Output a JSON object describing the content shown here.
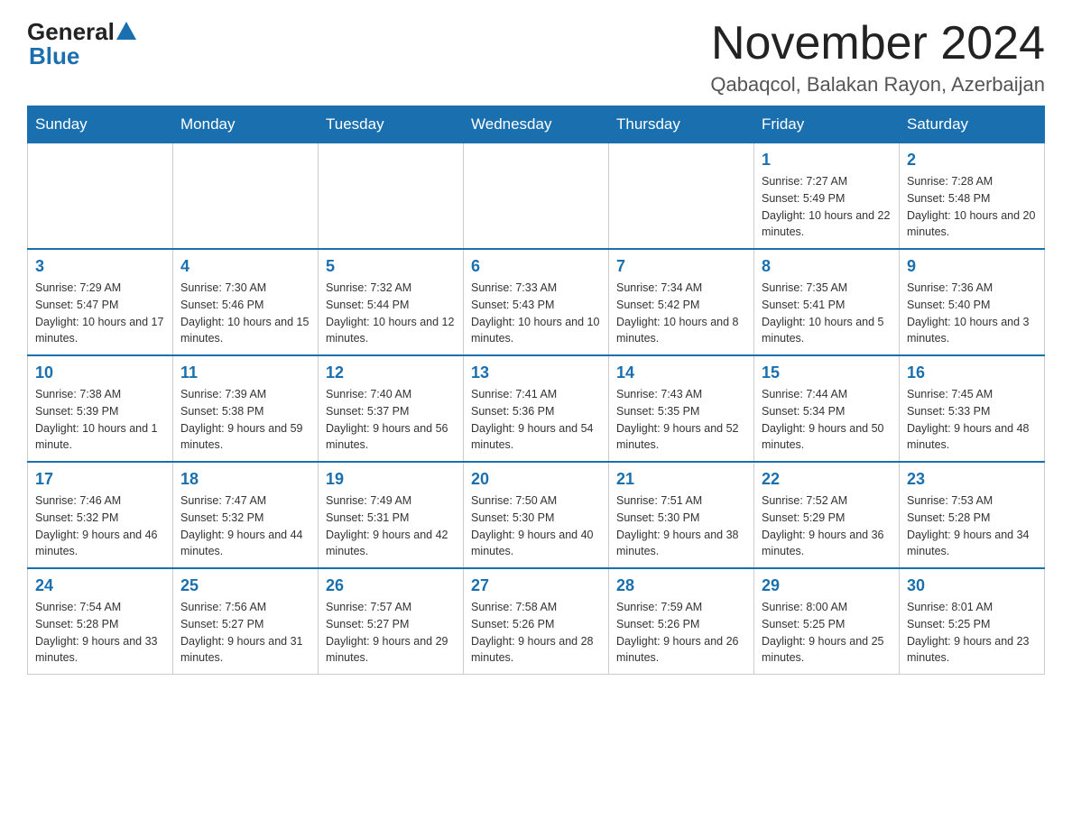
{
  "header": {
    "logo_general": "General",
    "logo_blue": "Blue",
    "month_title": "November 2024",
    "subtitle": "Qabaqcol, Balakan Rayon, Azerbaijan"
  },
  "weekdays": [
    "Sunday",
    "Monday",
    "Tuesday",
    "Wednesday",
    "Thursday",
    "Friday",
    "Saturday"
  ],
  "weeks": [
    [
      {
        "day": "",
        "info": ""
      },
      {
        "day": "",
        "info": ""
      },
      {
        "day": "",
        "info": ""
      },
      {
        "day": "",
        "info": ""
      },
      {
        "day": "",
        "info": ""
      },
      {
        "day": "1",
        "info": "Sunrise: 7:27 AM\nSunset: 5:49 PM\nDaylight: 10 hours and 22 minutes."
      },
      {
        "day": "2",
        "info": "Sunrise: 7:28 AM\nSunset: 5:48 PM\nDaylight: 10 hours and 20 minutes."
      }
    ],
    [
      {
        "day": "3",
        "info": "Sunrise: 7:29 AM\nSunset: 5:47 PM\nDaylight: 10 hours and 17 minutes."
      },
      {
        "day": "4",
        "info": "Sunrise: 7:30 AM\nSunset: 5:46 PM\nDaylight: 10 hours and 15 minutes."
      },
      {
        "day": "5",
        "info": "Sunrise: 7:32 AM\nSunset: 5:44 PM\nDaylight: 10 hours and 12 minutes."
      },
      {
        "day": "6",
        "info": "Sunrise: 7:33 AM\nSunset: 5:43 PM\nDaylight: 10 hours and 10 minutes."
      },
      {
        "day": "7",
        "info": "Sunrise: 7:34 AM\nSunset: 5:42 PM\nDaylight: 10 hours and 8 minutes."
      },
      {
        "day": "8",
        "info": "Sunrise: 7:35 AM\nSunset: 5:41 PM\nDaylight: 10 hours and 5 minutes."
      },
      {
        "day": "9",
        "info": "Sunrise: 7:36 AM\nSunset: 5:40 PM\nDaylight: 10 hours and 3 minutes."
      }
    ],
    [
      {
        "day": "10",
        "info": "Sunrise: 7:38 AM\nSunset: 5:39 PM\nDaylight: 10 hours and 1 minute."
      },
      {
        "day": "11",
        "info": "Sunrise: 7:39 AM\nSunset: 5:38 PM\nDaylight: 9 hours and 59 minutes."
      },
      {
        "day": "12",
        "info": "Sunrise: 7:40 AM\nSunset: 5:37 PM\nDaylight: 9 hours and 56 minutes."
      },
      {
        "day": "13",
        "info": "Sunrise: 7:41 AM\nSunset: 5:36 PM\nDaylight: 9 hours and 54 minutes."
      },
      {
        "day": "14",
        "info": "Sunrise: 7:43 AM\nSunset: 5:35 PM\nDaylight: 9 hours and 52 minutes."
      },
      {
        "day": "15",
        "info": "Sunrise: 7:44 AM\nSunset: 5:34 PM\nDaylight: 9 hours and 50 minutes."
      },
      {
        "day": "16",
        "info": "Sunrise: 7:45 AM\nSunset: 5:33 PM\nDaylight: 9 hours and 48 minutes."
      }
    ],
    [
      {
        "day": "17",
        "info": "Sunrise: 7:46 AM\nSunset: 5:32 PM\nDaylight: 9 hours and 46 minutes."
      },
      {
        "day": "18",
        "info": "Sunrise: 7:47 AM\nSunset: 5:32 PM\nDaylight: 9 hours and 44 minutes."
      },
      {
        "day": "19",
        "info": "Sunrise: 7:49 AM\nSunset: 5:31 PM\nDaylight: 9 hours and 42 minutes."
      },
      {
        "day": "20",
        "info": "Sunrise: 7:50 AM\nSunset: 5:30 PM\nDaylight: 9 hours and 40 minutes."
      },
      {
        "day": "21",
        "info": "Sunrise: 7:51 AM\nSunset: 5:30 PM\nDaylight: 9 hours and 38 minutes."
      },
      {
        "day": "22",
        "info": "Sunrise: 7:52 AM\nSunset: 5:29 PM\nDaylight: 9 hours and 36 minutes."
      },
      {
        "day": "23",
        "info": "Sunrise: 7:53 AM\nSunset: 5:28 PM\nDaylight: 9 hours and 34 minutes."
      }
    ],
    [
      {
        "day": "24",
        "info": "Sunrise: 7:54 AM\nSunset: 5:28 PM\nDaylight: 9 hours and 33 minutes."
      },
      {
        "day": "25",
        "info": "Sunrise: 7:56 AM\nSunset: 5:27 PM\nDaylight: 9 hours and 31 minutes."
      },
      {
        "day": "26",
        "info": "Sunrise: 7:57 AM\nSunset: 5:27 PM\nDaylight: 9 hours and 29 minutes."
      },
      {
        "day": "27",
        "info": "Sunrise: 7:58 AM\nSunset: 5:26 PM\nDaylight: 9 hours and 28 minutes."
      },
      {
        "day": "28",
        "info": "Sunrise: 7:59 AM\nSunset: 5:26 PM\nDaylight: 9 hours and 26 minutes."
      },
      {
        "day": "29",
        "info": "Sunrise: 8:00 AM\nSunset: 5:25 PM\nDaylight: 9 hours and 25 minutes."
      },
      {
        "day": "30",
        "info": "Sunrise: 8:01 AM\nSunset: 5:25 PM\nDaylight: 9 hours and 23 minutes."
      }
    ]
  ]
}
